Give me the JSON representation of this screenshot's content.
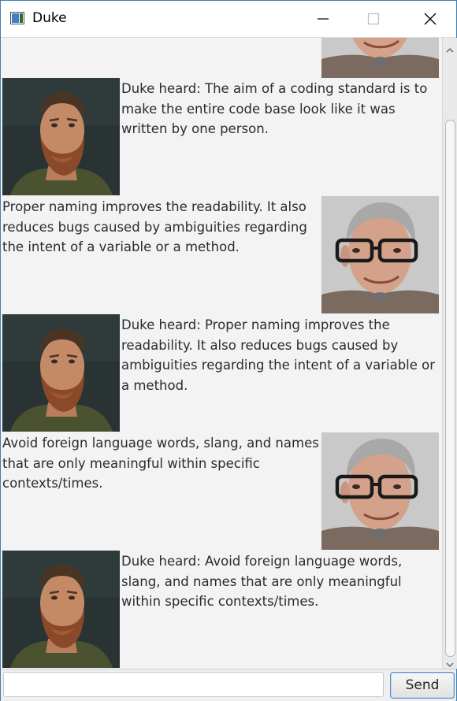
{
  "window": {
    "title": "Duke"
  },
  "dialogs": [
    {
      "speaker": "duke",
      "text": "Duke heard: The aim of a coding standard is to make the entire code base look like it was written by one person."
    },
    {
      "speaker": "user",
      "text": "Proper naming improves the readability. It also reduces bugs caused by ambiguities regarding the intent of a variable or a method."
    },
    {
      "speaker": "duke",
      "text": "Duke heard: Proper naming improves the readability. It also reduces bugs caused by ambiguities regarding the intent of a variable or a method."
    },
    {
      "speaker": "user",
      "text": "Avoid foreign language words, slang, and names that are only meaningful within specific contexts/times."
    },
    {
      "speaker": "duke",
      "text": "Duke heard: Avoid foreign language words, slang, and names that are only meaningful within specific contexts/times."
    }
  ],
  "input": {
    "value": "",
    "placeholder": ""
  },
  "send": {
    "label": "Send"
  },
  "icons": {
    "app": "window-app-icon",
    "minimize": "minimize-icon",
    "maximize": "maximize-icon",
    "close": "close-icon",
    "duke_avatar": "bearded-man-avatar",
    "user_avatar": "glasses-man-avatar"
  },
  "colors": {
    "background": "#f3f3f3",
    "accent_border": "#3c7fb1",
    "text": "#2b2b2b"
  }
}
